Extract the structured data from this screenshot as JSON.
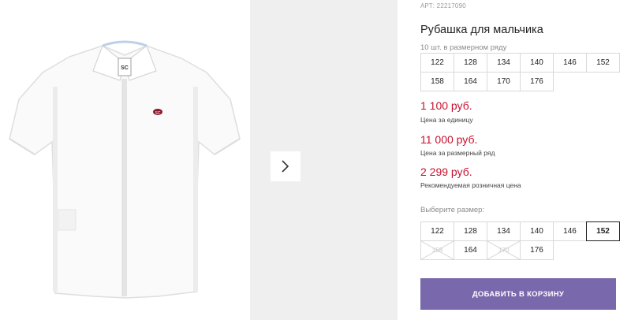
{
  "product": {
    "sku_label": "АРТ:",
    "sku_value": "22217090",
    "title": "Рубашка для мальчика",
    "pack_note": "10 шт. в размерном ряду",
    "pack_sizes": [
      "122",
      "128",
      "134",
      "140",
      "146",
      "152",
      "158",
      "164",
      "170",
      "176"
    ],
    "prices": [
      {
        "amount": "1 100 руб.",
        "label": "Цена за единицу"
      },
      {
        "amount": "11 000 руб.",
        "label": "Цена за размерный ряд"
      },
      {
        "amount": "2 299 руб.",
        "label": "Рекомендуемая розничная цена"
      }
    ],
    "select_label": "Выберите размер:",
    "select_sizes": [
      {
        "label": "122",
        "state": "available"
      },
      {
        "label": "128",
        "state": "available"
      },
      {
        "label": "134",
        "state": "available"
      },
      {
        "label": "140",
        "state": "available"
      },
      {
        "label": "146",
        "state": "available"
      },
      {
        "label": "152",
        "state": "selected"
      },
      {
        "label": "158",
        "state": "disabled"
      },
      {
        "label": "164",
        "state": "available"
      },
      {
        "label": "170",
        "state": "disabled"
      },
      {
        "label": "176",
        "state": "available"
      }
    ],
    "add_to_cart": "ДОБАВИТЬ В КОРЗИНУ"
  },
  "gallery": {
    "next_icon": "chevron-right-icon",
    "image_logo": "SC",
    "image_emblem": "SC"
  },
  "colors": {
    "price": "#c8102e",
    "cart_button": "#7a68ac",
    "gallery_side": "#efefef"
  }
}
